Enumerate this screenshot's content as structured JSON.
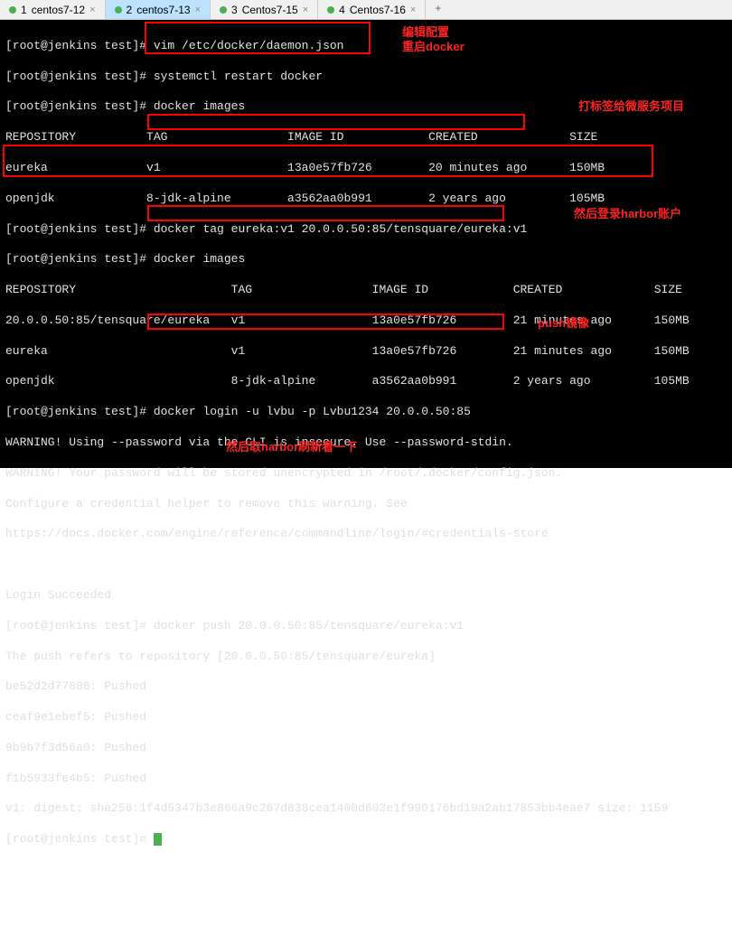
{
  "tabs": {
    "items": [
      {
        "num": "1",
        "label": "centos7-12"
      },
      {
        "num": "2",
        "label": "centos7-13"
      },
      {
        "num": "3",
        "label": "Centos7-15"
      },
      {
        "num": "4",
        "label": "Centos7-16"
      }
    ],
    "add": "+"
  },
  "prompt": "[root@jenkins test]#",
  "lines": {
    "l1": " vim /etc/docker/daemon.json",
    "l2": " systemctl restart docker",
    "l3": " docker images",
    "h1": "REPOSITORY          TAG                 IMAGE ID            CREATED             SIZE",
    "r1": "eureka              v1                  13a0e57fb726        20 minutes ago      150MB",
    "r2": "openjdk             8-jdk-alpine        a3562aa0b991        2 years ago         105MB",
    "l4": " docker tag eureka:v1 20.0.0.50:85/tensquare/eureka:v1",
    "l5": " docker images",
    "h2": "REPOSITORY                      TAG                 IMAGE ID            CREATED             SIZE",
    "r3": "20.0.0.50:85/tensquare/eureka   v1                  13a0e57fb726        21 minutes ago      150MB",
    "r4": "eureka                          v1                  13a0e57fb726        21 minutes ago      150MB",
    "r5": "openjdk                         8-jdk-alpine        a3562aa0b991        2 years ago         105MB",
    "l6": " docker login -u lvbu -p Lvbu1234 20.0.0.50:85",
    "w1": "WARNING! Using --password via the CLI is insecure. Use --password-stdin.",
    "w2": "WARNING! Your password will be stored unencrypted in /root/.docker/config.json.",
    "w3": "Configure a credential helper to remove this warning. See",
    "w4": "https://docs.docker.com/engine/reference/commandline/login/#credentials-store",
    "ls": "Login Succeeded",
    "l7": " docker push 20.0.0.50:85/tensquare/eureka:v1",
    "p1": "The push refers to repository [20.0.0.50:85/tensquare/eureka]",
    "p2": "be52d2d77808: Pushed",
    "p3": "ceaf9e1ebef5: Pushed",
    "p4": "9b9b7f3d56a0: Pushed",
    "p5": "f1b5933fe4b5: Pushed",
    "p6": "v1: digest: sha256:1f4d5347b3e866a9c267d838cea1400d603e1f990176bd19a2ab17853bb4eae7 size: 1159"
  },
  "annotations": {
    "a1": "编辑配置",
    "a2": "重启docker",
    "a3": "打标签给微服务项目",
    "a4": "然后登录harbor账户",
    "a5": "push镜像",
    "a6": "然后取harbor刷新看一下"
  }
}
